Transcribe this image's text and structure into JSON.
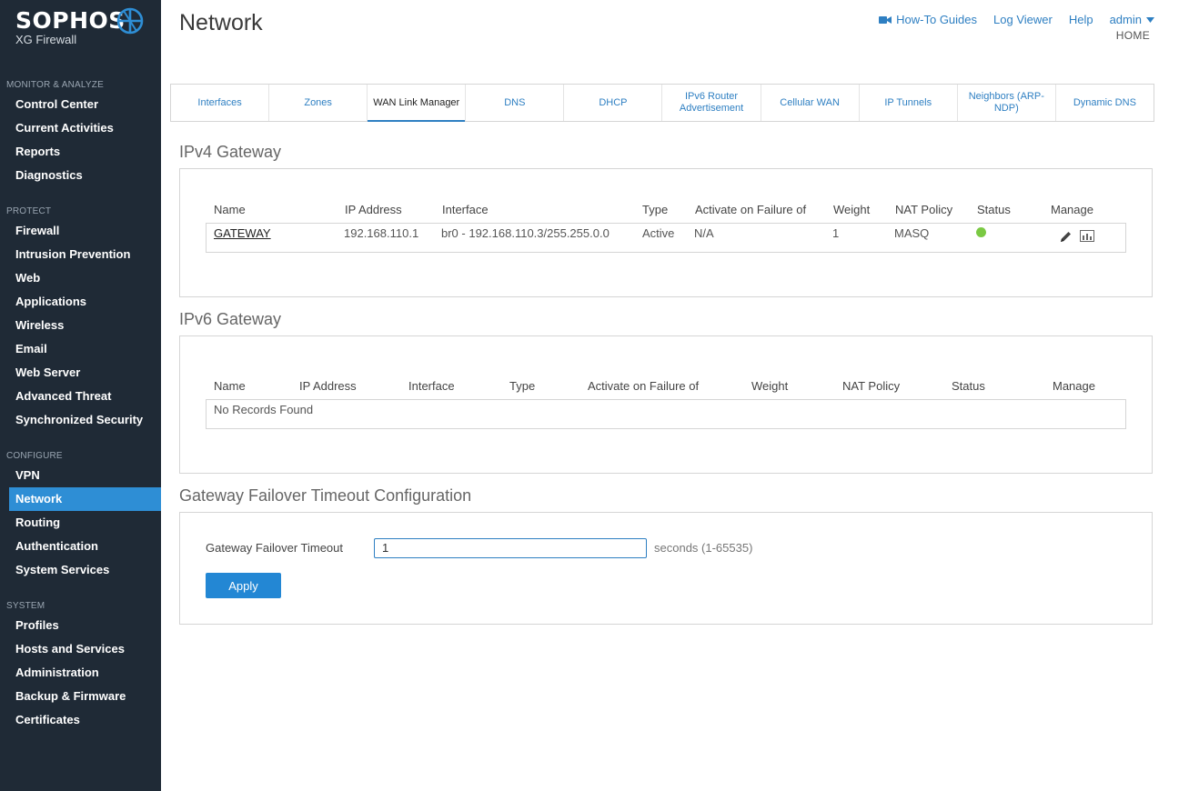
{
  "brand": {
    "name": "SOPHOS",
    "product": "XG Firewall"
  },
  "sidebar": {
    "groups": [
      {
        "heading": "MONITOR & ANALYZE",
        "items": [
          "Control Center",
          "Current Activities",
          "Reports",
          "Diagnostics"
        ]
      },
      {
        "heading": "PROTECT",
        "items": [
          "Firewall",
          "Intrusion Prevention",
          "Web",
          "Applications",
          "Wireless",
          "Email",
          "Web Server",
          "Advanced Threat",
          "Synchronized Security"
        ]
      },
      {
        "heading": "CONFIGURE",
        "items": [
          "VPN",
          "Network",
          "Routing",
          "Authentication",
          "System Services"
        ]
      },
      {
        "heading": "SYSTEM",
        "items": [
          "Profiles",
          "Hosts and Services",
          "Administration",
          "Backup & Firmware",
          "Certificates"
        ]
      }
    ],
    "active_item": "Network"
  },
  "header": {
    "title": "Network",
    "links": {
      "howto": "How-To Guides",
      "log": "Log Viewer",
      "help": "Help",
      "user": "admin"
    },
    "breadcrumb": "HOME"
  },
  "tabs": [
    "Interfaces",
    "Zones",
    "WAN Link Manager",
    "DNS",
    "DHCP",
    "IPv6 Router Advertisement",
    "Cellular WAN",
    "IP Tunnels",
    "Neighbors (ARP-NDP)",
    "Dynamic DNS"
  ],
  "active_tab": "WAN Link Manager",
  "ipv4": {
    "title": "IPv4 Gateway",
    "columns": [
      "Name",
      "IP Address",
      "Interface",
      "Type",
      "Activate on Failure of",
      "Weight",
      "NAT Policy",
      "Status",
      "Manage"
    ],
    "row": {
      "name": "GATEWAY",
      "ip": "192.168.110.1",
      "interface": "br0 - 192.168.110.3/255.255.0.0",
      "type": "Active",
      "failure_of": "N/A",
      "weight": "1",
      "nat": "MASQ",
      "status": "active"
    }
  },
  "ipv6": {
    "title": "IPv6 Gateway",
    "columns": [
      "Name",
      "IP Address",
      "Interface",
      "Type",
      "Activate on Failure of",
      "Weight",
      "NAT Policy",
      "Status",
      "Manage"
    ],
    "empty_text": "No Records Found"
  },
  "failover": {
    "title": "Gateway Failover Timeout Configuration",
    "label": "Gateway Failover Timeout",
    "value": "1",
    "hint": "seconds (1-65535)",
    "apply": "Apply"
  },
  "colors": {
    "sidebar_bg": "#1f2a36",
    "accent": "#2e8ed5",
    "status_ok": "#7ac943"
  }
}
